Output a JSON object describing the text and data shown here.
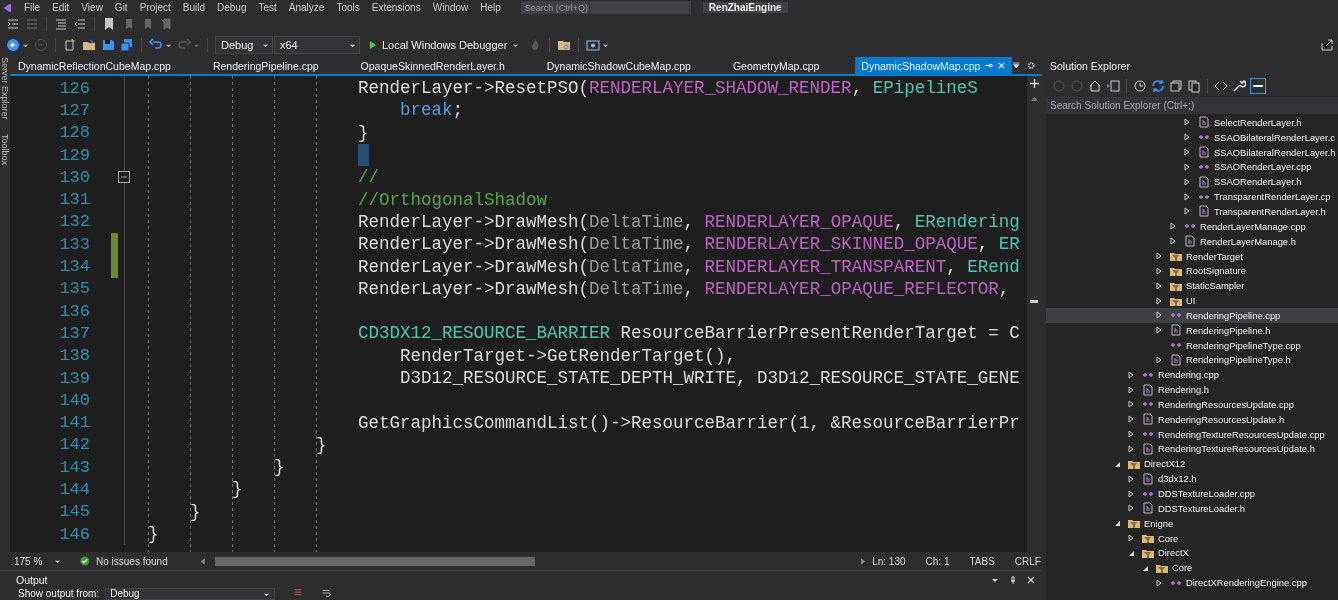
{
  "menu_bar": {
    "items": [
      "File",
      "Edit",
      "View",
      "Git",
      "Project",
      "Build",
      "Debug",
      "Test",
      "Analyze",
      "Tools",
      "Extensions",
      "Window",
      "Help"
    ],
    "search": {
      "placeholder": "Search (Ctrl+Q)"
    },
    "solution_name": "RenZhaiEngine"
  },
  "toolbar": {
    "configuration": "Debug",
    "platform": "x64",
    "run_button": "Local Windows Debugger"
  },
  "side_strip": [
    "Server Explorer",
    "Toolbox"
  ],
  "tabs": [
    {
      "label": "DynamicReflectionCubeMap.cpp",
      "selected": false
    },
    {
      "label": "RenderingPipeline.cpp",
      "selected": false
    },
    {
      "label": "OpaqueSkinnedRenderLayer.h",
      "selected": false
    },
    {
      "label": "DynamicShadowCubeMap.cpp",
      "selected": false
    },
    {
      "label": "GeometryMap.cpp",
      "selected": false
    },
    {
      "label": "DynamicShadowMap.cpp",
      "selected": true
    }
  ],
  "editor": {
    "lines": [
      {
        "n": "126",
        "changed": false,
        "fold": false,
        "cursor": false,
        "segs": [
          {
            "kind": "plain",
            "text": "                    RenderLayer->ResetPSO("
          },
          {
            "kind": "macro",
            "text": "RENDERLAYER_SHADOW_RENDER"
          },
          {
            "kind": "plain",
            "text": ", "
          },
          {
            "kind": "type",
            "text": "EPipelineS"
          }
        ]
      },
      {
        "n": "127",
        "changed": false,
        "fold": false,
        "cursor": false,
        "segs": [
          {
            "kind": "keyword",
            "text": "                        break"
          },
          {
            "kind": "plain",
            "text": ";"
          }
        ]
      },
      {
        "n": "128",
        "changed": false,
        "fold": false,
        "cursor": false,
        "segs": [
          {
            "kind": "plain",
            "text": "                    }"
          }
        ]
      },
      {
        "n": "129",
        "changed": false,
        "fold": false,
        "cursor": true
      },
      {
        "n": "130",
        "changed": false,
        "fold": true,
        "cursor": false,
        "segs": [
          {
            "kind": "comment",
            "text": "                    //"
          }
        ]
      },
      {
        "n": "131",
        "changed": false,
        "fold": false,
        "cursor": false,
        "segs": [
          {
            "kind": "comment",
            "text": "                    //OrthogonalShadow"
          }
        ]
      },
      {
        "n": "132",
        "changed": false,
        "fold": false,
        "cursor": false,
        "segs": [
          {
            "kind": "plain",
            "text": "                    RenderLayer->DrawMesh("
          },
          {
            "kind": "param",
            "text": "DeltaTime"
          },
          {
            "kind": "plain",
            "text": ", "
          },
          {
            "kind": "macro",
            "text": "RENDERLAYER_OPAQUE"
          },
          {
            "kind": "plain",
            "text": ", "
          },
          {
            "kind": "type",
            "text": "ERendering"
          }
        ]
      },
      {
        "n": "133",
        "changed": true,
        "fold": false,
        "cursor": false,
        "segs": [
          {
            "kind": "plain",
            "text": "                    RenderLayer->DrawMesh("
          },
          {
            "kind": "param",
            "text": "DeltaTime"
          },
          {
            "kind": "plain",
            "text": ", "
          },
          {
            "kind": "macro",
            "text": "RENDERLAYER_SKINNED_OPAQUE"
          },
          {
            "kind": "plain",
            "text": ", "
          },
          {
            "kind": "type",
            "text": "ER"
          }
        ]
      },
      {
        "n": "134",
        "changed": true,
        "fold": false,
        "cursor": false,
        "segs": [
          {
            "kind": "plain",
            "text": "                    RenderLayer->DrawMesh("
          },
          {
            "kind": "param",
            "text": "DeltaTime"
          },
          {
            "kind": "plain",
            "text": ", "
          },
          {
            "kind": "macro",
            "text": "RENDERLAYER_TRANSPARENT"
          },
          {
            "kind": "plain",
            "text": ", "
          },
          {
            "kind": "type",
            "text": "ERend"
          }
        ]
      },
      {
        "n": "135",
        "changed": false,
        "fold": false,
        "cursor": false,
        "segs": [
          {
            "kind": "plain",
            "text": "                    RenderLayer->DrawMesh("
          },
          {
            "kind": "param",
            "text": "DeltaTime"
          },
          {
            "kind": "plain",
            "text": ", "
          },
          {
            "kind": "macro",
            "text": "RENDERLAYER_OPAQUE_REFLECTOR"
          },
          {
            "kind": "plain",
            "text": ","
          }
        ]
      },
      {
        "n": "136",
        "changed": false,
        "fold": false,
        "cursor": false
      },
      {
        "n": "137",
        "changed": false,
        "fold": false,
        "cursor": false,
        "segs": [
          {
            "kind": "type",
            "text": "                    CD3DX12_RESOURCE_BARRIER"
          },
          {
            "kind": "plain",
            "text": " ResourceBarrierPresentRenderTarget = C"
          }
        ]
      },
      {
        "n": "138",
        "changed": false,
        "fold": false,
        "cursor": false,
        "segs": [
          {
            "kind": "plain",
            "text": "                        RenderTarget->GetRenderTarget(),"
          }
        ]
      },
      {
        "n": "139",
        "changed": false,
        "fold": false,
        "cursor": false,
        "segs": [
          {
            "kind": "plain",
            "text": "                        D3D12_RESOURCE_STATE_DEPTH_WRITE, D3D12_RESOURCE_STATE_GENE"
          }
        ]
      },
      {
        "n": "140",
        "changed": false,
        "fold": false,
        "cursor": false
      },
      {
        "n": "141",
        "changed": false,
        "fold": false,
        "cursor": false,
        "segs": [
          {
            "kind": "plain",
            "text": "                    GetGraphicsCommandList()->ResourceBarrier(1, &ResourceBarrierPr"
          }
        ]
      },
      {
        "n": "142",
        "changed": false,
        "fold": false,
        "cursor": false,
        "segs": [
          {
            "kind": "plain",
            "text": "                }"
          }
        ]
      },
      {
        "n": "143",
        "changed": false,
        "fold": false,
        "cursor": false,
        "segs": [
          {
            "kind": "plain",
            "text": "            }"
          }
        ]
      },
      {
        "n": "144",
        "changed": false,
        "fold": false,
        "cursor": false,
        "segs": [
          {
            "kind": "plain",
            "text": "        }"
          }
        ]
      },
      {
        "n": "145",
        "changed": false,
        "fold": false,
        "cursor": false,
        "segs": [
          {
            "kind": "plain",
            "text": "    }"
          }
        ]
      },
      {
        "n": "146",
        "changed": false,
        "fold": false,
        "cursor": false,
        "segs": [
          {
            "kind": "plain",
            "text": "}"
          }
        ]
      }
    ]
  },
  "status_bar": {
    "zoom": "175 %",
    "issues": "No issues found",
    "line": "Ln: 130",
    "column": "Ch: 1",
    "indent": "TABS",
    "line_ending": "CRLF"
  },
  "output": {
    "title": "Output",
    "source_label": "Show output from:",
    "source": "Debug"
  },
  "solution_explorer": {
    "title": "Solution Explorer",
    "search": {
      "placeholder": "Search Solution Explorer (Ctrl+;)"
    },
    "tree": [
      {
        "children": [
          {
            "children": [
              {
                "children": [
                  {
                    "children": [
                      {
                        "children": [
                          {
                            "label": "SelectRenderLayer.h",
                            "kind": "h",
                            "expandable": true,
                            "expanded": false,
                            "selected": false
                          },
                          {
                            "label": "SSAOBilateralRenderLayer.c",
                            "kind": "cpp",
                            "expandable": true,
                            "expanded": false,
                            "selected": false
                          },
                          {
                            "label": "SSAOBilateralRenderLayer.h",
                            "kind": "h",
                            "expandable": true,
                            "expanded": false,
                            "selected": false
                          },
                          {
                            "label": "SSAORenderLayer.cpp",
                            "kind": "cpp",
                            "expandable": true,
                            "expanded": false,
                            "selected": false
                          },
                          {
                            "label": "SSAORenderLayer.h",
                            "kind": "h",
                            "expandable": true,
                            "expanded": false,
                            "selected": false
                          },
                          {
                            "label": "TransparentRenderLayer.cp",
                            "kind": "cpp",
                            "expandable": true,
                            "expanded": false,
                            "selected": false
                          },
                          {
                            "label": "TransparentRenderLayer.h",
                            "kind": "h",
                            "expandable": true,
                            "expanded": false,
                            "selected": false
                          }
                        ]
                      },
                      {
                        "label": "RenderLayerManage.cpp",
                        "kind": "cpp",
                        "expandable": true,
                        "expanded": false,
                        "selected": false
                      },
                      {
                        "label": "RenderLayerManage.h",
                        "kind": "h",
                        "expandable": true,
                        "expanded": false,
                        "selected": false
                      }
                    ]
                  },
                  {
                    "label": "RenderTarget",
                    "kind": "folder",
                    "expandable": true,
                    "expanded": false,
                    "selected": false
                  },
                  {
                    "label": "RootSignature",
                    "kind": "folder",
                    "expandable": true,
                    "expanded": false,
                    "selected": false
                  },
                  {
                    "label": "StaticSampler",
                    "kind": "folder",
                    "expandable": true,
                    "expanded": false,
                    "selected": false
                  },
                  {
                    "label": "UI",
                    "kind": "folder",
                    "expandable": true,
                    "expanded": false,
                    "selected": false
                  },
                  {
                    "label": "RenderingPipeline.cpp",
                    "kind": "cpp",
                    "expandable": true,
                    "expanded": false,
                    "selected": true
                  },
                  {
                    "label": "RenderingPipeline.h",
                    "kind": "h",
                    "expandable": true,
                    "expanded": false,
                    "selected": false
                  },
                  {
                    "label": "RenderingPipelineType.cpp",
                    "kind": "cpp",
                    "expandable": false,
                    "selected": false
                  },
                  {
                    "label": "RenderingPipelineType.h",
                    "kind": "h",
                    "expandable": true,
                    "expanded": false,
                    "selected": false
                  }
                ]
              }
            ]
          },
          {
            "label": "Rendering.cpp",
            "kind": "cpp",
            "expandable": true,
            "expanded": false,
            "selected": false
          },
          {
            "label": "Rendering.h",
            "kind": "h",
            "expandable": true,
            "expanded": false,
            "selected": false
          },
          {
            "label": "RenderingResourcesUpdate.cpp",
            "kind": "cpp",
            "expandable": true,
            "expanded": false,
            "selected": false
          },
          {
            "label": "RenderingResourcesUpdate.h",
            "kind": "h",
            "expandable": true,
            "expanded": false,
            "selected": false
          },
          {
            "label": "RenderingTextureResourcesUpdate.cpp",
            "kind": "cpp",
            "expandable": true,
            "expanded": false,
            "selected": false
          },
          {
            "label": "RenderingTextureResourcesUpdate.h",
            "kind": "h",
            "expandable": true,
            "expanded": false,
            "selected": false
          }
        ]
      },
      {
        "label": "DirectX12",
        "kind": "folder",
        "expandable": true,
        "expanded": true,
        "selected": false,
        "children": [
          {
            "label": "d3dx12.h",
            "kind": "h",
            "expandable": true,
            "expanded": false,
            "selected": false
          },
          {
            "label": "DDSTextureLoader.cpp",
            "kind": "cpp",
            "expandable": true,
            "expanded": false,
            "selected": false
          },
          {
            "label": "DDSTextureLoader.h",
            "kind": "h",
            "expandable": true,
            "expanded": false,
            "selected": false
          }
        ]
      },
      {
        "label": "Enigne",
        "kind": "folder",
        "expandable": true,
        "expanded": true,
        "selected": false,
        "children": [
          {
            "label": "Core",
            "kind": "folder",
            "expandable": true,
            "expanded": false,
            "selected": false
          },
          {
            "label": "DirectX",
            "kind": "folder",
            "expandable": true,
            "expanded": true,
            "selected": false,
            "children": [
              {
                "label": "Core",
                "kind": "folder",
                "expandable": true,
                "expanded": true,
                "selected": false,
                "children": [
                  {
                    "label": "DirectXRenderingEngine.cpp",
                    "kind": "cpp",
                    "expandable": true,
                    "expanded": false,
                    "selected": false
                  }
                ]
              }
            ]
          }
        ]
      }
    ]
  }
}
